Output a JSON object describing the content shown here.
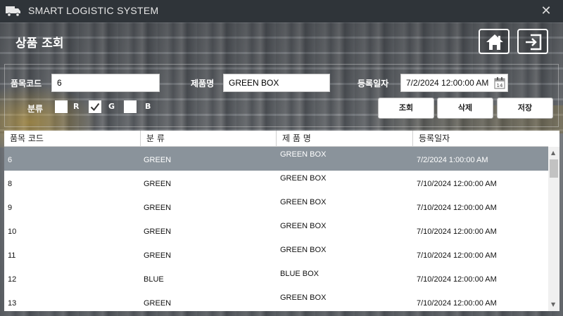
{
  "app": {
    "title": "SMART LOGISTIC SYSTEM",
    "close_glyph": "✕",
    "truck_icon": "truck-icon"
  },
  "header": {
    "page_title": "상품 조회",
    "home_icon": "home-icon",
    "exit_icon": "sign-out-icon"
  },
  "filters": {
    "item_code_label": "품목코드",
    "item_code_value": "6",
    "product_name_label": "제품명",
    "product_name_value": "GREEN BOX",
    "reg_date_label": "등록일자",
    "reg_date_value": "7/2/2024 12:00:00 AM",
    "calendar_icon": "calendar-icon",
    "category_label": "분류",
    "categories": [
      {
        "label": "R",
        "checked": false
      },
      {
        "label": "G",
        "checked": true
      },
      {
        "label": "B",
        "checked": false
      }
    ]
  },
  "buttons": {
    "search": "조회",
    "delete": "삭제",
    "save": "저장"
  },
  "table": {
    "columns": [
      "품목 코드",
      "분 류",
      "제 품 명",
      "등록일자"
    ],
    "rows": [
      {
        "code": "6",
        "category": "GREEN",
        "name": "GREEN BOX",
        "date": "7/2/2024 1:00:00 AM",
        "selected": true
      },
      {
        "code": "8",
        "category": "GREEN",
        "name": "GREEN BOX",
        "date": "7/10/2024 12:00:00 AM",
        "selected": false
      },
      {
        "code": "9",
        "category": "GREEN",
        "name": "GREEN BOX",
        "date": "7/10/2024 12:00:00 AM",
        "selected": false
      },
      {
        "code": "10",
        "category": "GREEN",
        "name": "GREEN BOX",
        "date": "7/10/2024 12:00:00 AM",
        "selected": false
      },
      {
        "code": "11",
        "category": "GREEN",
        "name": "GREEN BOX",
        "date": "7/10/2024 12:00:00 AM",
        "selected": false
      },
      {
        "code": "12",
        "category": "BLUE",
        "name": "BLUE BOX",
        "date": "7/10/2024 12:00:00 AM",
        "selected": false
      },
      {
        "code": "13",
        "category": "GREEN",
        "name": "GREEN BOX",
        "date": "7/10/2024 12:00:00 AM",
        "selected": false
      }
    ],
    "selected_row_color": "#8a939b"
  }
}
